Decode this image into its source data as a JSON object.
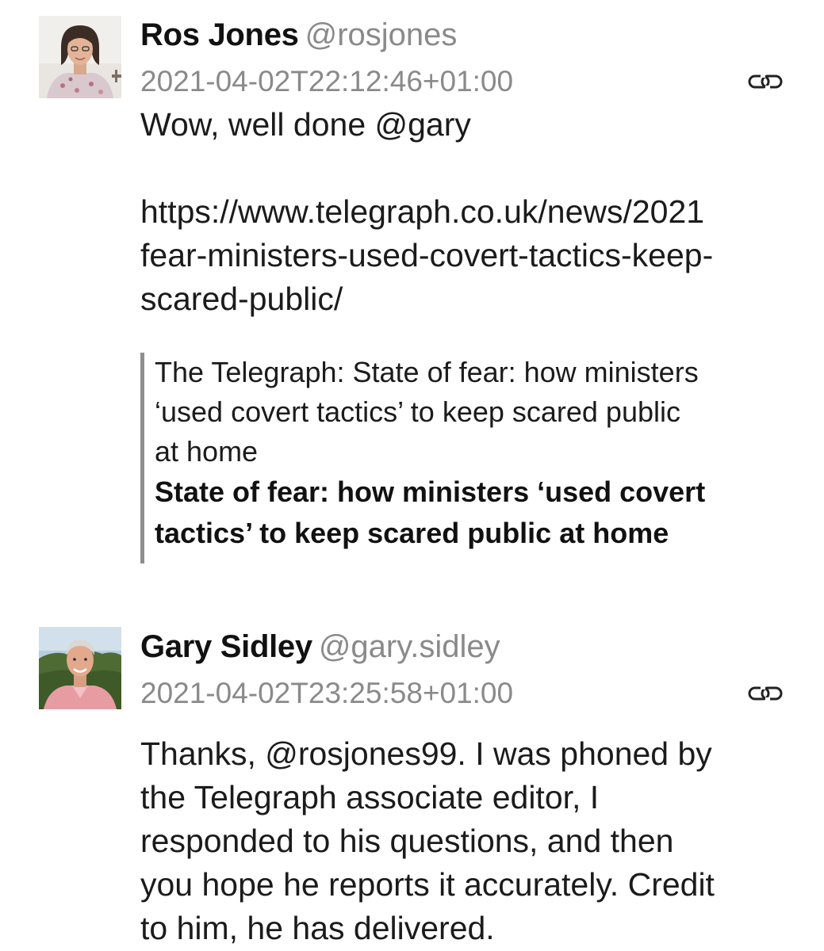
{
  "posts": [
    {
      "author": {
        "name": "Ros Jones",
        "handle": "@rosjones"
      },
      "timestamp": "2021-04-02T22:12:46+01:00",
      "body_lines": [
        "Wow, well done @gary"
      ],
      "url_lines": [
        "https://www.telegraph.co.uk/news/2021",
        "fear-ministers-used-covert-tactics-keep-",
        "scared-public/"
      ],
      "link_card": {
        "source_lines": [
          "The Telegraph: State of fear: how ministers",
          "‘used covert tactics’ to keep scared public",
          "at home"
        ],
        "title_lines": [
          "State of fear: how ministers ‘used covert",
          "tactics’ to keep scared public at home"
        ]
      },
      "icons": [
        "avatar",
        "link-icon"
      ]
    },
    {
      "author": {
        "name": "Gary Sidley",
        "handle": "@gary.sidley"
      },
      "timestamp": "2021-04-02T23:25:58+01:00",
      "body_lines": [
        "Thanks, @rosjones99. I was phoned by",
        "the Telegraph associate editor, I",
        "responded to his questions, and then",
        "you hope he reports it accurately. Credit",
        "to him, he has delivered."
      ],
      "icons": [
        "avatar",
        "link-icon"
      ]
    }
  ],
  "colors": {
    "name": "#111111",
    "muted": "#8a8a8a",
    "body": "#1b1b1b",
    "quote_border": "#8e8e8e",
    "background": "#ffffff"
  }
}
